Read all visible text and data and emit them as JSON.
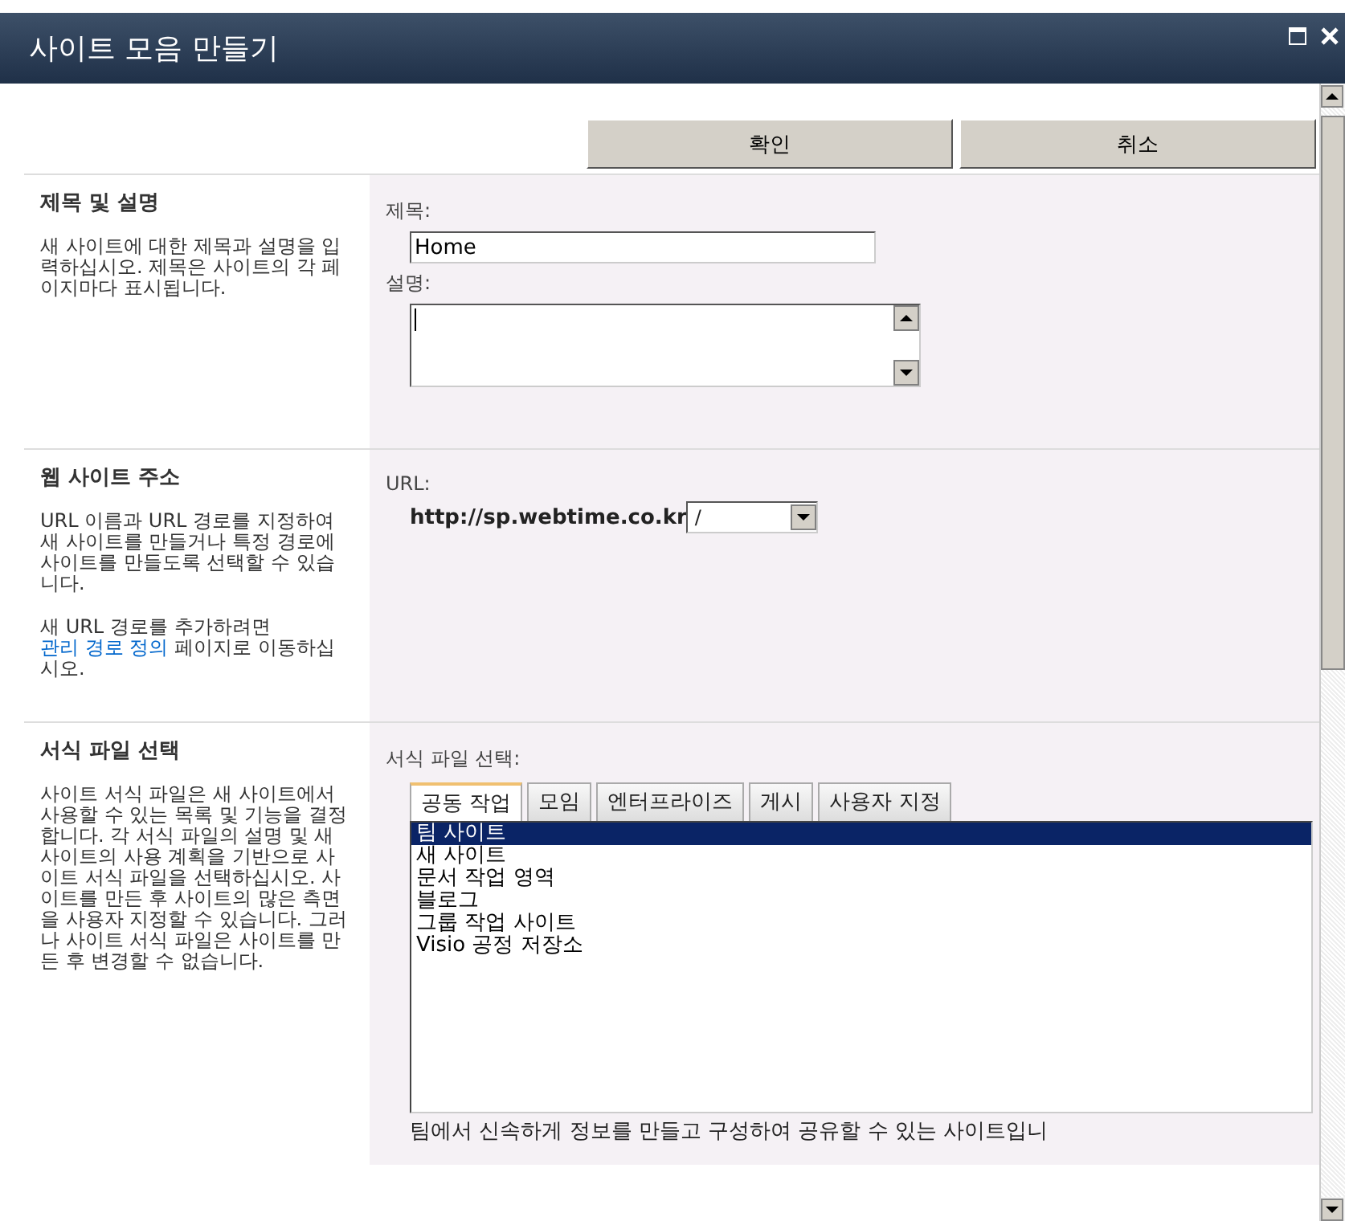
{
  "window": {
    "title": "사이트 모음 만들기"
  },
  "buttons": [
    {
      "label": "확인"
    },
    {
      "label": "취소"
    }
  ],
  "sections": [
    {
      "kind": "title",
      "heading": "제목 및 설명",
      "paragraphs": [
        {
          "text": "새 사이트에 대한 제목과 설명을 입력하십시오. 제목은 사이트의 각 페이지마다 표시됩니다."
        }
      ],
      "title_label": "제목:",
      "title_value": "Home",
      "description_label": "설명:"
    },
    {
      "kind": "url",
      "heading": "웹 사이트 주소",
      "paragraphs": [
        {
          "text": "URL 이름과 URL 경로를 지정하여 새 사이트를 만들거나 특정 경로에 사이트를 만들도록 선택할 수 있습니다."
        },
        {
          "text": "새 URL 경로를 추가하려면 ",
          "link": "관리 경로 정의",
          "after": " 페이지로 이동하십시오."
        }
      ],
      "url_label": "URL:",
      "url_prefix": "http://sp.webtime.co.kr",
      "path_value": "/"
    },
    {
      "kind": "template",
      "heading": "서식 파일 선택",
      "paragraphs": [
        {
          "text": "사이트 서식 파일은 새 사이트에서 사용할 수 있는 목록 및 기능을 결정합니다. 각 서식 파일의 설명 및 새 사이트의 사용 계획을 기반으로 사이트 서식 파일을 선택하십시오. 사이트를 만든 후 사이트의 많은 측면을 사용자 지정할 수 있습니다. 그러나 사이트 서식 파일은 사이트를 만든 후 변경할 수 없습니다."
        }
      ],
      "template_label": "서식 파일 선택:",
      "tabs": [
        {
          "label": "공동 작업",
          "selected": true
        },
        {
          "label": "모임",
          "selected": false
        },
        {
          "label": "엔터프라이즈",
          "selected": false
        },
        {
          "label": "게시",
          "selected": false
        },
        {
          "label": "사용자 지정",
          "selected": false
        }
      ],
      "templates": [
        {
          "label": "팀 사이트",
          "selected": true
        },
        {
          "label": "새 사이트",
          "selected": false
        },
        {
          "label": "문서 작업 영역",
          "selected": false
        },
        {
          "label": "블로그",
          "selected": false
        },
        {
          "label": "그룹 작업 사이트",
          "selected": false
        },
        {
          "label": "Visio 공정 저장소",
          "selected": false
        }
      ],
      "template_description": "팀에서 신속하게 정보를 만들고 구성하여 공유할 수 있는 사이트입니"
    }
  ]
}
